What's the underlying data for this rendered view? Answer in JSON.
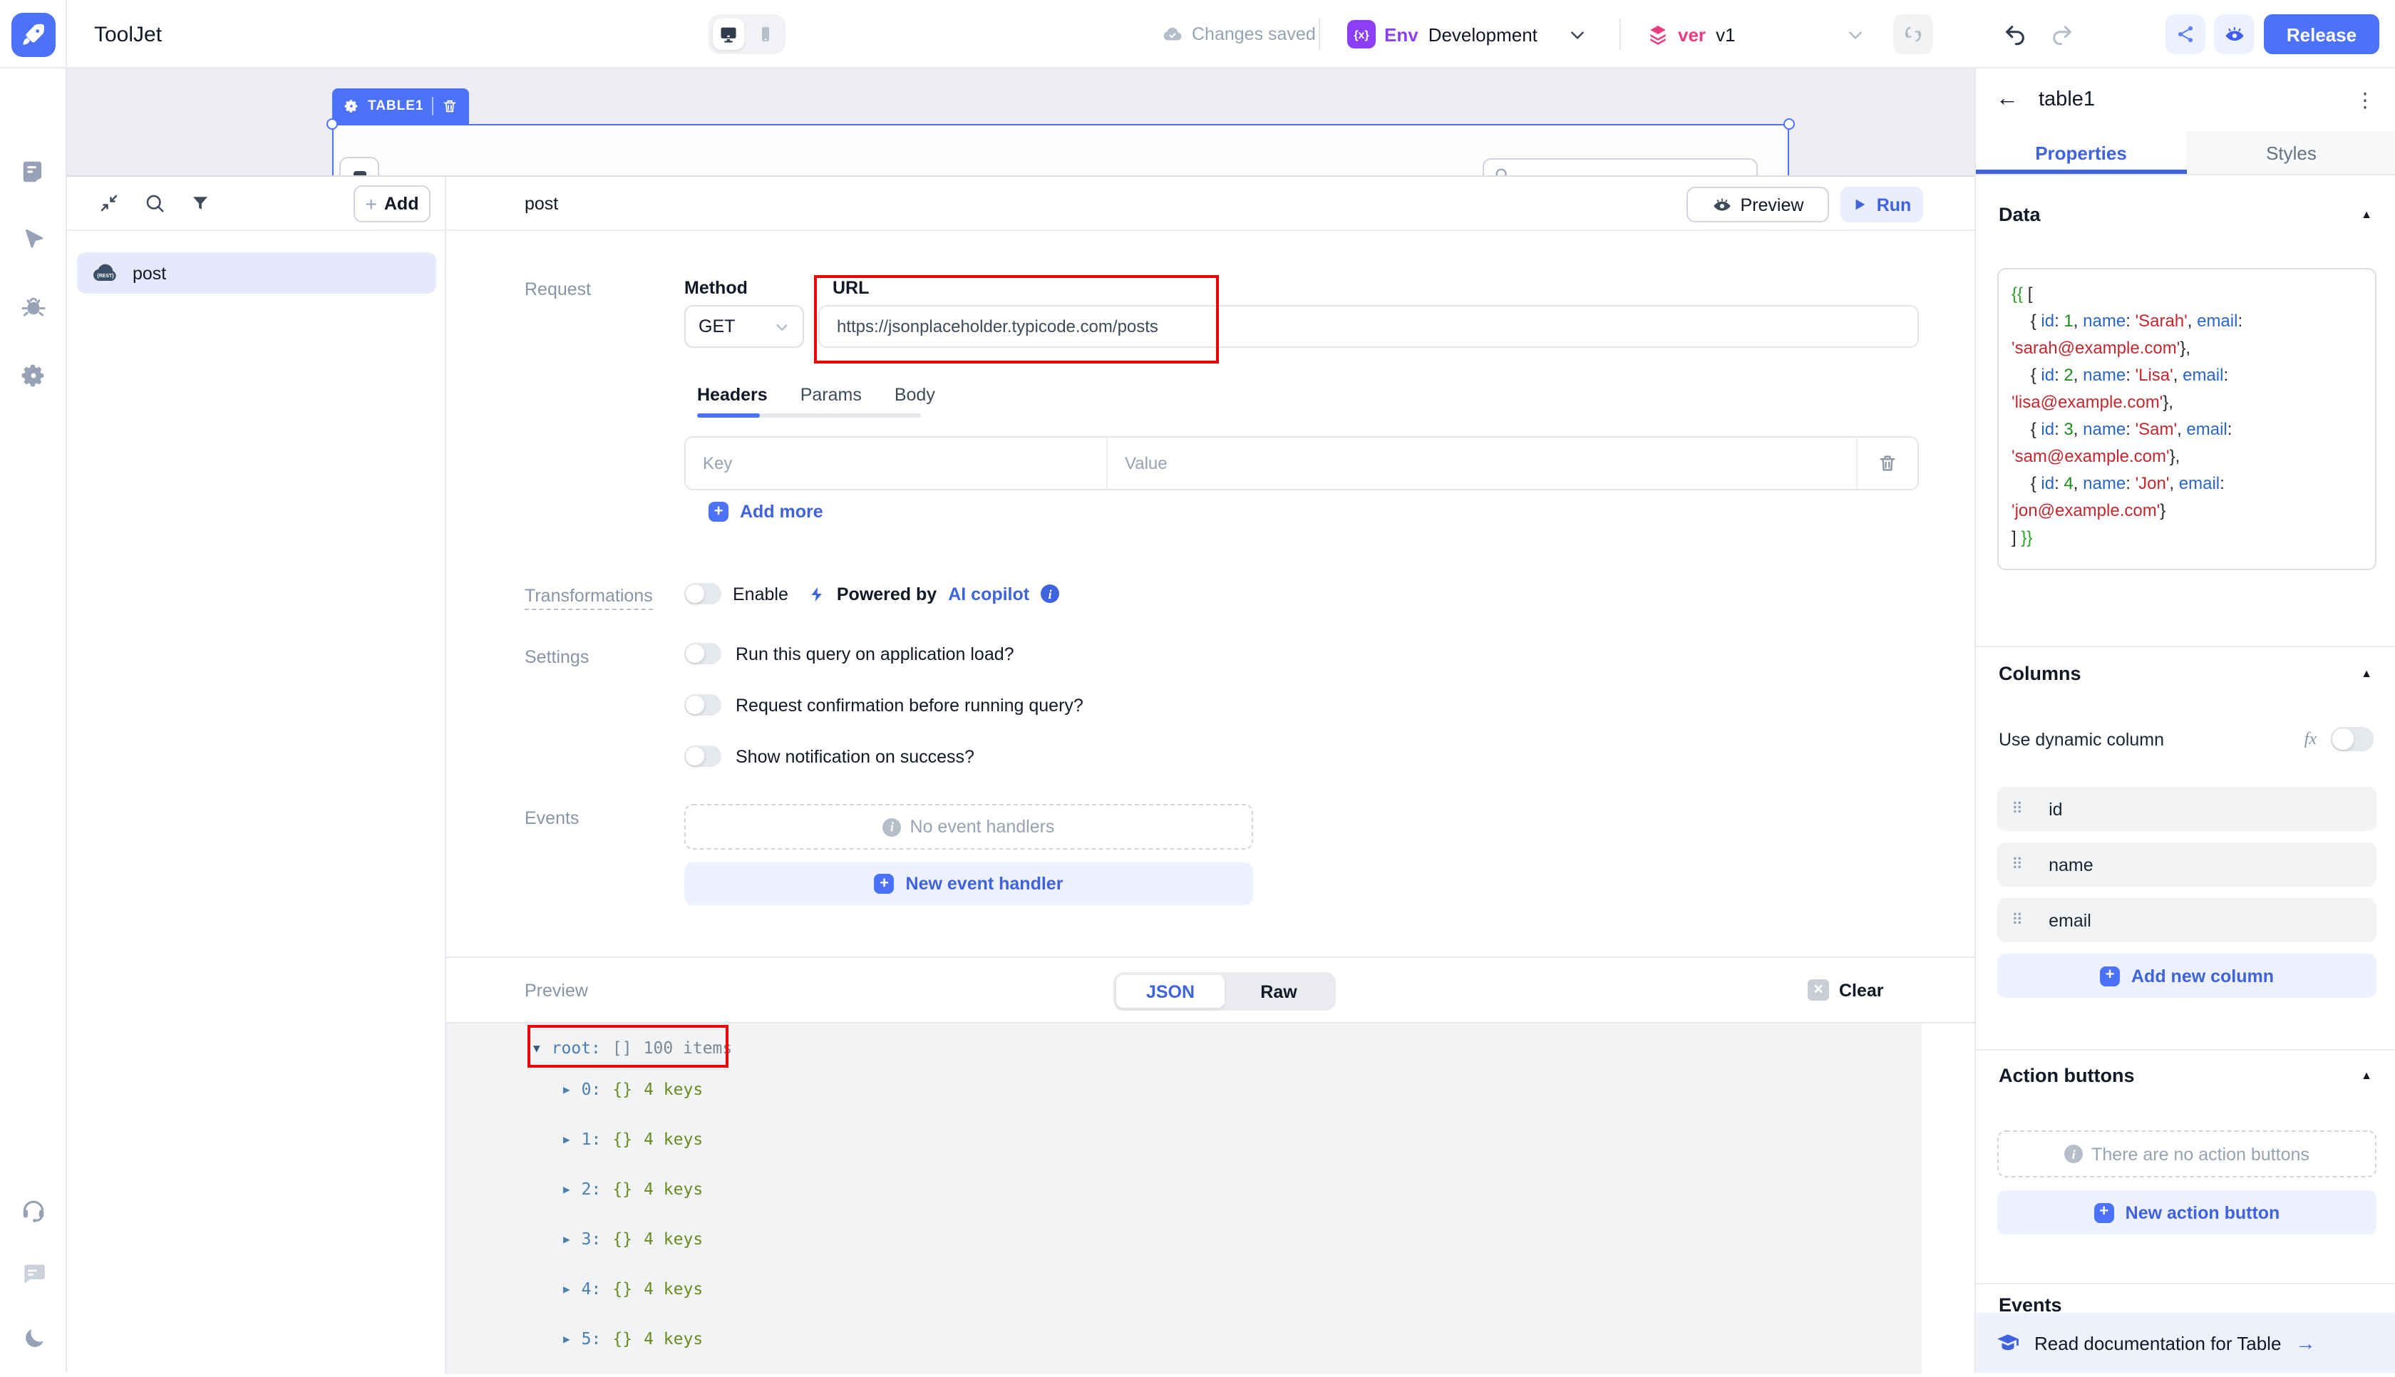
{
  "header": {
    "app_title": "ToolJet",
    "autosave_status": "Changes saved",
    "env_badge": "{x}",
    "env_label": "Env",
    "env_value": "Development",
    "ver_label": "ver",
    "ver_value": "v1",
    "release_label": "Release"
  },
  "canvas": {
    "widget_tag": "TABLE1"
  },
  "query_list": {
    "add_button": "Add",
    "selected_query": "post"
  },
  "editor": {
    "query_name": "post",
    "preview_button": "Preview",
    "run_button": "Run",
    "request_label": "Request",
    "method_label": "Method",
    "method_value": "GET",
    "url_label": "URL",
    "url_value": "https://jsonplaceholder.typicode.com/posts",
    "tabs": [
      "Headers",
      "Params",
      "Body"
    ],
    "key_placeholder": "Key",
    "value_placeholder": "Value",
    "add_more_label": "Add more",
    "transformations_label": "Transformations",
    "enable_label": "Enable",
    "powered_by": "Powered by",
    "ai_copilot": "AI copilot",
    "settings_label": "Settings",
    "settings": [
      "Run this query on application load?",
      "Request confirmation before running query?",
      "Show notification on success?"
    ],
    "events_label": "Events",
    "no_event_handlers": "No event handlers",
    "new_event_handler": "New event handler"
  },
  "preview": {
    "label": "Preview",
    "tabs": [
      "JSON",
      "Raw"
    ],
    "active_tab": "JSON",
    "clear_label": "Clear",
    "root": {
      "label": "root:",
      "bracket": "[]",
      "count": "100 items"
    },
    "items": [
      {
        "index": "0:",
        "braces": "{}",
        "keys": "4 keys"
      },
      {
        "index": "1:",
        "braces": "{}",
        "keys": "4 keys"
      },
      {
        "index": "2:",
        "braces": "{}",
        "keys": "4 keys"
      },
      {
        "index": "3:",
        "braces": "{}",
        "keys": "4 keys"
      },
      {
        "index": "4:",
        "braces": "{}",
        "keys": "4 keys"
      },
      {
        "index": "5:",
        "braces": "{}",
        "keys": "4 keys"
      }
    ]
  },
  "inspector": {
    "widget_name": "table1",
    "tabs": [
      "Properties",
      "Styles"
    ],
    "active_tab": "Properties",
    "data_section": {
      "title": "Data",
      "code_lines": [
        [
          [
            "{{",
            "g"
          ],
          [
            " [",
            "k"
          ]
        ],
        [
          [
            "    { ",
            "k"
          ],
          [
            "id",
            "b"
          ],
          [
            ": ",
            "k"
          ],
          [
            "1",
            "n"
          ],
          [
            ", ",
            "k"
          ],
          [
            "name",
            "b"
          ],
          [
            ": ",
            "k"
          ],
          [
            "'Sarah'",
            "r"
          ],
          [
            ", ",
            "k"
          ],
          [
            "email",
            "b"
          ],
          [
            ":",
            "k"
          ]
        ],
        [
          [
            "'sarah@example.com'",
            "r"
          ],
          [
            "},",
            "k"
          ]
        ],
        [
          [
            "    { ",
            "k"
          ],
          [
            "id",
            "b"
          ],
          [
            ": ",
            "k"
          ],
          [
            "2",
            "n"
          ],
          [
            ", ",
            "k"
          ],
          [
            "name",
            "b"
          ],
          [
            ": ",
            "k"
          ],
          [
            "'Lisa'",
            "r"
          ],
          [
            ", ",
            "k"
          ],
          [
            "email",
            "b"
          ],
          [
            ":",
            "k"
          ]
        ],
        [
          [
            "'lisa@example.com'",
            "r"
          ],
          [
            "},",
            "k"
          ]
        ],
        [
          [
            "    { ",
            "k"
          ],
          [
            "id",
            "b"
          ],
          [
            ": ",
            "k"
          ],
          [
            "3",
            "n"
          ],
          [
            ", ",
            "k"
          ],
          [
            "name",
            "b"
          ],
          [
            ": ",
            "k"
          ],
          [
            "'Sam'",
            "r"
          ],
          [
            ", ",
            "k"
          ],
          [
            "email",
            "b"
          ],
          [
            ":",
            "k"
          ]
        ],
        [
          [
            "'sam@example.com'",
            "r"
          ],
          [
            "},",
            "k"
          ]
        ],
        [
          [
            "    { ",
            "k"
          ],
          [
            "id",
            "b"
          ],
          [
            ": ",
            "k"
          ],
          [
            "4",
            "n"
          ],
          [
            ", ",
            "k"
          ],
          [
            "name",
            "b"
          ],
          [
            ": ",
            "k"
          ],
          [
            "'Jon'",
            "r"
          ],
          [
            ", ",
            "k"
          ],
          [
            "email",
            "b"
          ],
          [
            ":",
            "k"
          ]
        ],
        [
          [
            "'jon@example.com'",
            "r"
          ],
          [
            "}",
            "k"
          ]
        ],
        [
          [
            "] ",
            "k"
          ],
          [
            "}}",
            "g"
          ]
        ]
      ]
    },
    "columns_section": {
      "title": "Columns",
      "dynamic_label": "Use dynamic column",
      "items": [
        "id",
        "name",
        "email"
      ],
      "add_label": "Add new column"
    },
    "action_buttons_section": {
      "title": "Action buttons",
      "empty_label": "There are no action buttons",
      "add_label": "New action button"
    },
    "events_title": "Events",
    "footer_doc_label": "Read documentation for Table"
  },
  "colors": {
    "primary_blue": "#4d72fa",
    "link_blue": "#3e63dd",
    "env_purple": "#8b3ff6",
    "ver_pink": "#e93d82",
    "annotation_red": "#ee0202",
    "tree_index_blue": "#4a7fb0",
    "tree_green": "#6c8a1f"
  }
}
